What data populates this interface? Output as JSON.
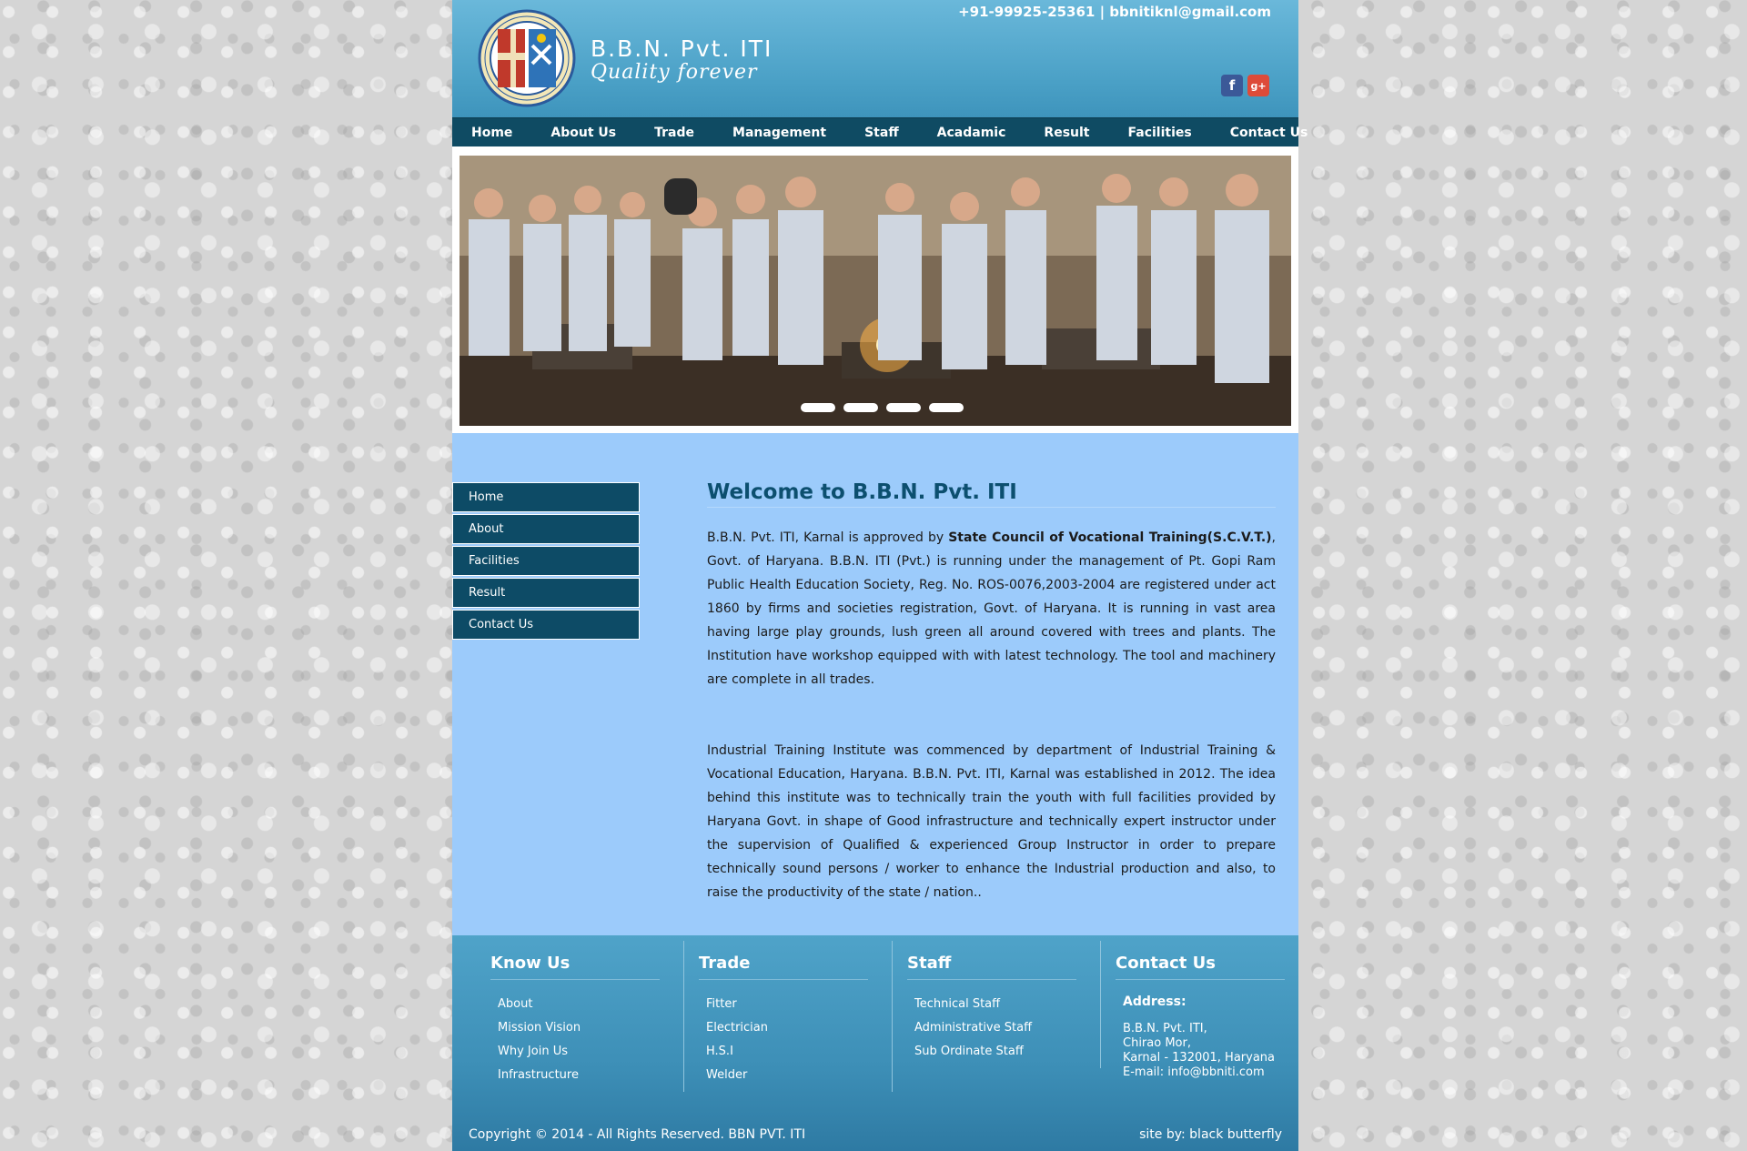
{
  "header": {
    "brand_name": "B.B.N. Pvt. ITI",
    "brand_tagline": "Quality forever",
    "contact": "+91-99925-25361 | bbnitiknl@gmail.com",
    "social": [
      {
        "name": "facebook-icon",
        "glyph": "f"
      },
      {
        "name": "googleplus-icon",
        "glyph": "g+"
      }
    ]
  },
  "nav": {
    "items": [
      "Home",
      "About Us",
      "Trade",
      "Management",
      "Staff",
      "Acadamic",
      "Result",
      "Facilities",
      "Contact Us"
    ]
  },
  "slider": {
    "slide_count": 4
  },
  "sidebar": {
    "items": [
      "Home",
      "About",
      "Facilities",
      "Result",
      "Contact Us"
    ]
  },
  "main": {
    "title": "Welcome to B.B.N. Pvt. ITI",
    "para1_a": "B.B.N. Pvt. ITI, Karnal is approved by ",
    "para1_bold": "State Council of Vocational Training(S.C.V.T.)",
    "para1_b": ", Govt. of Haryana. B.B.N. ITI (Pvt.) is running under the management of Pt. Gopi Ram Public Health Education Society, Reg. No. ROS-0076,2003-2004 are registered under act 1860 by firms and societies registration, Govt. of Haryana. It is running in vast area having large play grounds, lush green all around covered with trees and plants. The Institution have workshop equipped with with latest technology. The tool and machinery are complete in all trades.",
    "para2": "Industrial Training Institute was commenced by department of Industrial Training & Vocational Education, Haryana. B.B.N. Pvt. ITI, Karnal was established in 2012. The idea behind this institute was to technically train the youth with full facilities provided by Haryana Govt. in shape of Good infrastructure and technically expert instructor under the supervision of Qualified & experienced Group Instructor in order to prepare technically sound persons / worker to enhance the Industrial production and also, to raise the productivity of the state / nation.."
  },
  "footer": {
    "know_us": {
      "title": "Know Us",
      "links": [
        "About",
        "Mission Vision",
        "Why Join Us",
        "Infrastructure"
      ]
    },
    "trade": {
      "title": "Trade",
      "links": [
        "Fitter",
        "Electrician",
        "H.S.I",
        "Welder"
      ]
    },
    "staff": {
      "title": "Staff",
      "links": [
        "Technical Staff",
        "Administrative Staff",
        "Sub Ordinate Staff"
      ]
    },
    "contact": {
      "title": "Contact Us",
      "address_label": "Address:",
      "address_lines": [
        "B.B.N. Pvt. ITI,",
        "Chirao Mor,",
        "Karnal - 132001, Haryana",
        "E-mail: info@bbniti.com"
      ]
    },
    "copyright": "Copyright © 2014 - All Rights Reserved. BBN PVT. ITI",
    "credit": "site by: black butterfly"
  }
}
